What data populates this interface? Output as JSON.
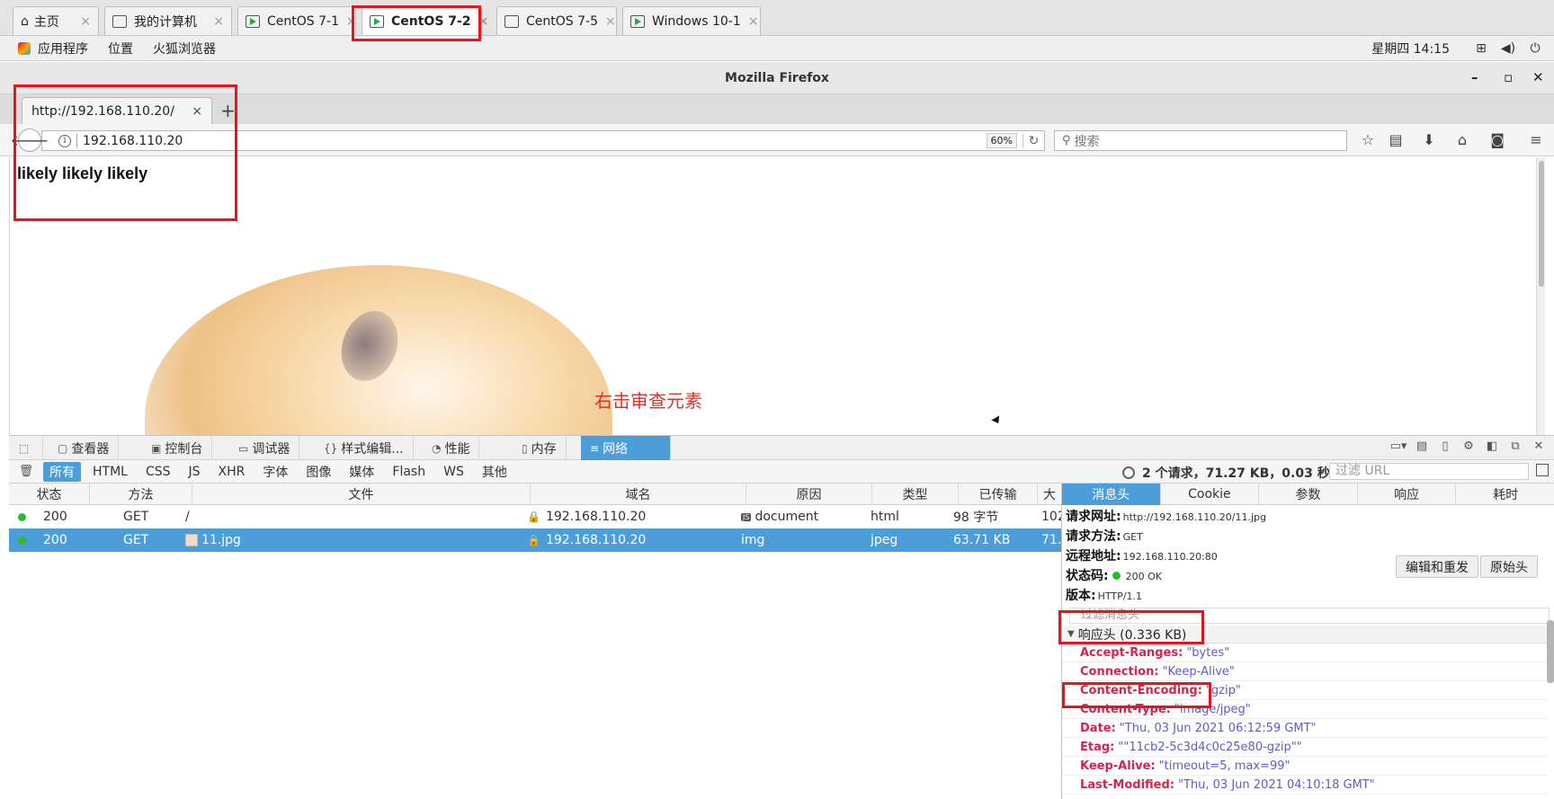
{
  "vm_tabs": {
    "home": "主页",
    "my_computer": "我的计算机",
    "centos71": "CentOS 7-1",
    "centos72": "CentOS 7-2",
    "centos75": "CentOS 7-5",
    "win10": "Windows 10-1",
    "close_glyph": "×"
  },
  "gnome": {
    "apps": "应用程序",
    "places": "位置",
    "browser": "火狐浏览器",
    "clock": "星期四 14:15"
  },
  "firefox": {
    "window_title": "Mozilla Firefox",
    "tab_title": "http://192.168.110.20/",
    "tab_close": "×",
    "new_tab": "+",
    "url": "192.168.110.20",
    "zoom": "60%",
    "search_placeholder": "搜索"
  },
  "page": {
    "text": "likely likely likely",
    "annotation": "右击审查元素"
  },
  "devtools": {
    "tabs": {
      "inspector": "查看器",
      "console": "控制台",
      "debugger": "调试器",
      "style_editor": "样式编辑...",
      "performance": "性能",
      "memory": "内存",
      "network": "网络"
    },
    "filters": {
      "all": "所有",
      "html": "HTML",
      "css": "CSS",
      "js": "JS",
      "xhr": "XHR",
      "fonts": "字体",
      "images": "图像",
      "media": "媒体",
      "flash": "Flash",
      "ws": "WS",
      "other": "其他"
    },
    "summary": "2 个请求，71.27 KB，0.03 秒",
    "url_filter_placeholder": "过滤 URL",
    "columns": {
      "status": "状态",
      "method": "方法",
      "file": "文件",
      "domain": "域名",
      "cause": "原因",
      "type": "类型",
      "transferred": "已传输",
      "size": "大"
    },
    "requests": [
      {
        "status": "200",
        "method": "GET",
        "file": "/",
        "domain": "192.168.110.20",
        "cause": "document",
        "type": "html",
        "transferred": "98 字节",
        "size": "102"
      },
      {
        "status": "200",
        "method": "GET",
        "file": "11.jpg",
        "domain": "192.168.110.20",
        "cause": "img",
        "type": "jpeg",
        "transferred": "63.71 KB",
        "size": "71."
      }
    ],
    "details": {
      "tabs": {
        "headers": "消息头",
        "cookies": "Cookie",
        "params": "参数",
        "response": "响应",
        "timings": "耗时"
      },
      "request_url_label": "请求网址:",
      "request_url": "http://192.168.110.20/11.jpg",
      "method_label": "请求方法:",
      "method": "GET",
      "remote_label": "远程地址:",
      "remote": "192.168.110.20:80",
      "status_label": "状态码:",
      "status": "200  OK",
      "version_label": "版本:",
      "version": "HTTP/1.1",
      "edit_resend": "编辑和重发",
      "raw_headers": "原始头",
      "filter_headers": "过滤消息头",
      "response_headers_title": "响应头 (0.336 KB)",
      "response_headers": [
        {
          "name": "Accept-Ranges:",
          "value": "\"bytes\""
        },
        {
          "name": "Connection:",
          "value": "\"Keep-Alive\""
        },
        {
          "name": "Content-Encoding:",
          "value": "\"gzip\""
        },
        {
          "name": "Content-Type:",
          "value": "\"image/jpeg\""
        },
        {
          "name": "Date:",
          "value": "\"Thu, 03 Jun 2021 06:12:59 GMT\""
        },
        {
          "name": "Etag:",
          "value": "\"\"11cb2-5c3d4c0c25e80-gzip\"\""
        },
        {
          "name": "Keep-Alive:",
          "value": "\"timeout=5, max=99\""
        },
        {
          "name": "Last-Modified:",
          "value": "\"Thu, 03 Jun 2021 04:10:18 GMT\""
        }
      ]
    }
  },
  "colors": {
    "accent": "#4c9ed9",
    "highlight_red": "#e8141b",
    "status_green": "#2cbb2c"
  }
}
